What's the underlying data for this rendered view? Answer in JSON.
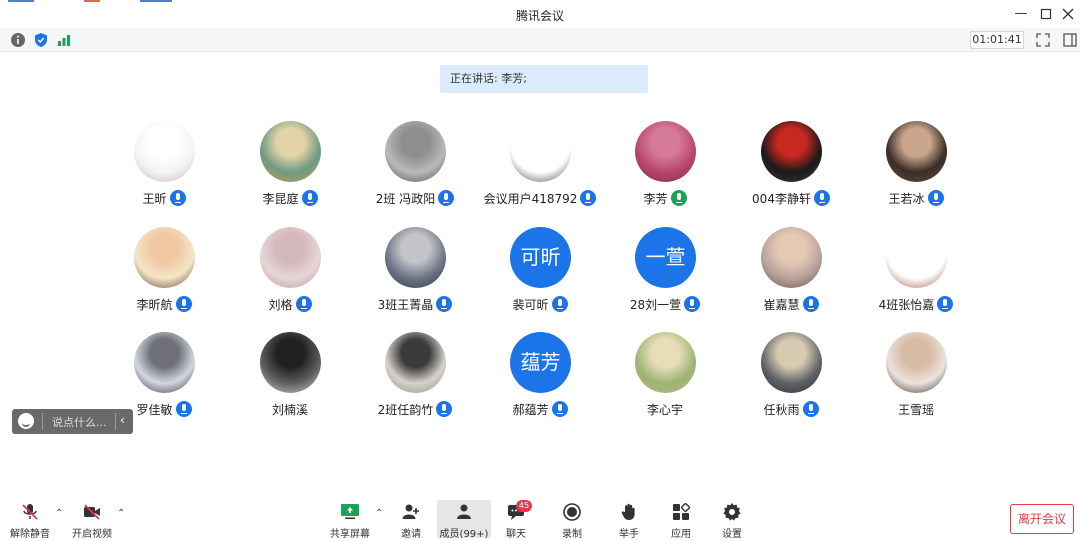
{
  "window": {
    "title": "腾讯会议",
    "timer": "01:01:41"
  },
  "speaking": "正在讲话: 李芳;",
  "participants": [
    {
      "name": "王昕",
      "avatar": "dog-illustration",
      "mic": "on"
    },
    {
      "name": "李昆庭",
      "avatar": "cartoon-photo",
      "mic": "on"
    },
    {
      "name": "2班 冯政阳",
      "avatar": "gray-silhouette-photo",
      "mic": "on"
    },
    {
      "name": "会议用户418792",
      "avatar": "line-drawing",
      "mic": "on"
    },
    {
      "name": "李芳",
      "avatar": "flowers-photo",
      "mic": "speaking"
    },
    {
      "name": "004李静轩",
      "avatar": "red-figure-photo",
      "mic": "on"
    },
    {
      "name": "王若冰",
      "avatar": "portrait-photo",
      "mic": "on"
    },
    {
      "name": "李昕航",
      "avatar": "cartoon-girl",
      "mic": "on"
    },
    {
      "name": "刘格",
      "avatar": "soft-portrait-photo",
      "mic": "on"
    },
    {
      "name": "3班王菁晶",
      "avatar": "group-photo",
      "mic": "on"
    },
    {
      "name": "裴可昕",
      "avatar_text": "可昕",
      "mic": "on"
    },
    {
      "name": "28刘一萱",
      "avatar_text": "一萱",
      "mic": "on"
    },
    {
      "name": "崔嘉慧",
      "avatar": "two-people-photo",
      "mic": "on"
    },
    {
      "name": "4班张怡嘉",
      "avatar": "bear-illustration",
      "mic": "on"
    },
    {
      "name": "罗佳敏",
      "avatar": "cat-illustration",
      "mic": "on"
    },
    {
      "name": "刘楠溪",
      "avatar": "dark-portrait-photo",
      "mic": "none"
    },
    {
      "name": "2班任韵竹",
      "avatar": "anime-sketch",
      "mic": "on"
    },
    {
      "name": "郝蕴芳",
      "avatar_text": "蕴芳",
      "mic": "on"
    },
    {
      "name": "李心宇",
      "avatar": "clay-figure-photo",
      "mic": "none"
    },
    {
      "name": "任秋雨",
      "avatar": "anime-character",
      "mic": "on"
    },
    {
      "name": "王雪瑶",
      "avatar": "person-photo",
      "mic": "none"
    }
  ],
  "chat_input": {
    "placeholder": "说点什么..."
  },
  "toolbar": {
    "unmute": "解除静音",
    "start_video": "开启视频",
    "share_screen": "共享屏幕",
    "invite": "邀请",
    "members": "成员(99+)",
    "chat": "聊天",
    "chat_badge": "45",
    "record": "录制",
    "raise_hand": "举手",
    "apps": "应用",
    "settings": "设置",
    "leave": "离开会议"
  },
  "colors": {
    "accent": "#1b74e8",
    "speaking": "#19a35a",
    "danger": "#e5384a"
  }
}
